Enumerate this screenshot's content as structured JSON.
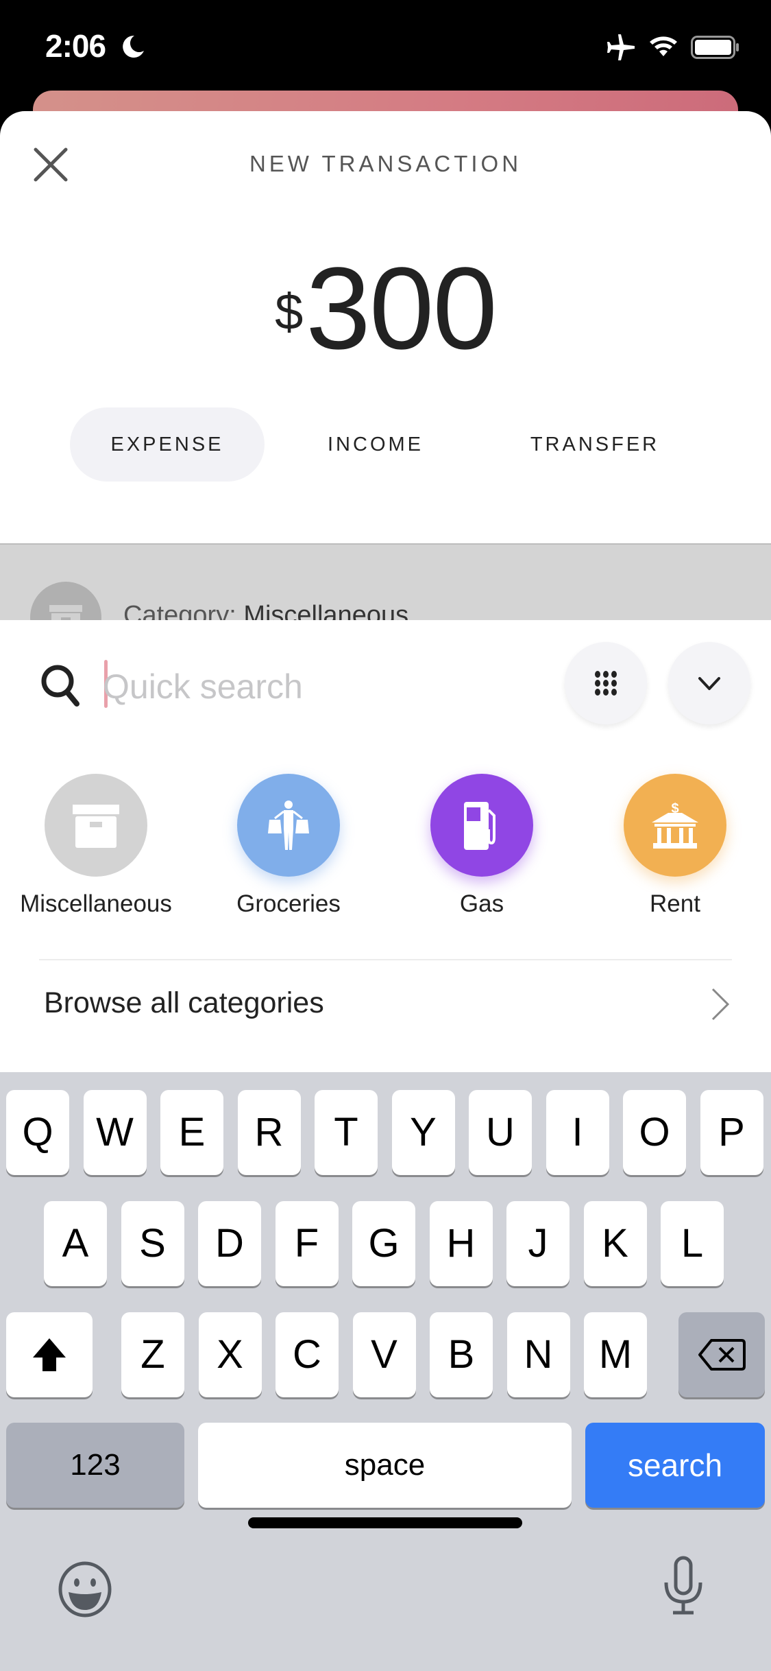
{
  "status_bar": {
    "time": "2:06",
    "icons": [
      "moon-icon",
      "airplane-icon",
      "wifi-icon",
      "battery-icon"
    ]
  },
  "sheet": {
    "title": "NEW TRANSACTION",
    "close_icon": "close-icon",
    "amount": {
      "currency": "$",
      "value": "300"
    },
    "type_tabs": [
      {
        "label": "EXPENSE",
        "active": true
      },
      {
        "label": "INCOME",
        "active": false
      },
      {
        "label": "TRANSFER",
        "active": false
      }
    ],
    "category_row": {
      "prefix": "Category:",
      "value": "Miscellaneous"
    }
  },
  "picker": {
    "search": {
      "placeholder": "Quick search",
      "value": ""
    },
    "grid_button_icon": "grid-icon",
    "collapse_button_icon": "chevron-down-icon",
    "categories": [
      {
        "label": "Miscellaneous",
        "icon": "archive-box-icon",
        "color": "#d3d3d3"
      },
      {
        "label": "Groceries",
        "icon": "shopping-bags-person-icon",
        "color": "#80aeea"
      },
      {
        "label": "Gas",
        "icon": "gas-pump-icon",
        "color": "#9046e4"
      },
      {
        "label": "Rent",
        "icon": "bank-building-icon",
        "color": "#f2b052"
      }
    ],
    "browse_all_label": "Browse all categories"
  },
  "keyboard": {
    "row1": [
      "Q",
      "W",
      "E",
      "R",
      "T",
      "Y",
      "U",
      "I",
      "O",
      "P"
    ],
    "row2": [
      "A",
      "S",
      "D",
      "F",
      "G",
      "H",
      "J",
      "K",
      "L"
    ],
    "row3": [
      "Z",
      "X",
      "C",
      "V",
      "B",
      "N",
      "M"
    ],
    "numbers_label": "123",
    "space_label": "space",
    "return_label": "search",
    "return_color": "#347cf6"
  }
}
